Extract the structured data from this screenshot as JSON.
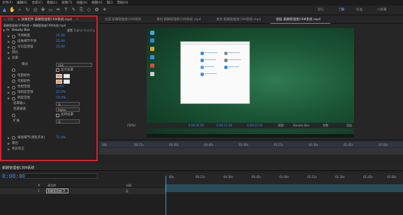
{
  "menu": [
    "文件(F)",
    "编辑(E)",
    "合成(C)",
    "图层(L)",
    "效果(T)",
    "动画(A)",
    "视图(V)",
    "窗口",
    "帮助(H)"
  ],
  "toolbar_icons": [
    "selection-tool",
    "hand-tool",
    "zoom-tool",
    "rotate-tool",
    "orbit-tool",
    "pan-behind-tool",
    "rect-mask-tool",
    "pen-tool",
    "text-tool",
    "brush-tool",
    "clone-tool",
    "eraser-tool",
    "roto-tool",
    "puppet-tool"
  ],
  "workspaces": [
    "默认",
    "了解",
    "标准",
    "小屏幕"
  ],
  "effect_panel": {
    "tabs": [
      "× 项目",
      "× 效果控件 薪酬管理者CRM系统.mp4",
      "≡"
    ],
    "path": "薪酬管理者CRM系统 • 薪酬管理者CRM系统.mp4",
    "effect_name": "Beauty Box",
    "reset_label": "重置",
    "preset_label": "Digital Anarchy",
    "rows": [
      {
        "label": "平滑数量",
        "value": "25.00",
        "kind": "stopwatch"
      },
      {
        "label": "皮肤细节平滑",
        "value": "35.00",
        "kind": "stopwatch"
      },
      {
        "label": "对比度增强",
        "value": "15.00",
        "kind": "stopwatch"
      },
      {
        "label": "锐化",
        "value": "",
        "kind": "group"
      },
      {
        "label": "遮罩",
        "value": "",
        "kind": "group-open"
      },
      {
        "label": "模式",
        "value": "自动",
        "kind": "dropdown"
      },
      {
        "label": "",
        "value": "显示遮罩",
        "kind": "checkbox"
      },
      {
        "label": "暗部颜色",
        "value": "",
        "kind": "color"
      },
      {
        "label": "亮部颜色",
        "value": "",
        "kind": "color"
      },
      {
        "label": "色相范围",
        "value": "5.0%",
        "kind": "stopwatch"
      },
      {
        "label": "饱和度范围",
        "value": "20.0%",
        "kind": "stopwatch"
      },
      {
        "label": "明度范围",
        "value": "50.0%",
        "kind": "stopwatch"
      },
      {
        "label": "遮罩输入",
        "value": "无",
        "kind": "dropdown"
      },
      {
        "label": "遮罩通道",
        "value": "Alpha",
        "kind": "dropdown"
      },
      {
        "label": "",
        "value": "反转遮罩",
        "kind": "checkbox"
      },
      {
        "label": "扩展",
        "value": "无",
        "kind": "dropdown"
      },
      {
        "label": "",
        "value": "",
        "kind": "spacer"
      },
      {
        "label": "",
        "value": "",
        "kind": "spacer"
      },
      {
        "label": "阈值细节(阴影开关)",
        "value": "75.0%",
        "kind": "stopwatch"
      },
      {
        "label": "输出",
        "value": "",
        "kind": "group"
      },
      {
        "label": "色彩校正",
        "value": "",
        "kind": "group"
      }
    ]
  },
  "composition_tabs": [
    {
      "label": "合成 薪酬管理者CRM系统",
      "active": false
    },
    {
      "label": "素材 薪酬管理者CRM系统.mp4",
      "active": false
    },
    {
      "label": "素材 薪酬管理者CRM系统.mp4",
      "active": false
    },
    {
      "label": "图层 薪酬管理者CRM系统.mp4",
      "active": true
    }
  ],
  "viewer_controls": {
    "zoom": "(50%)",
    "timecode_left": "0:00:00:00",
    "timecode_mid": "0:00:21:18",
    "timecode_right": "0:00:21:18",
    "view_label": "视图:",
    "render_label": "Beauty Box",
    "render_toggle": "渲染",
    "resolution": "完整"
  },
  "mini_timeline_ticks": [
    "00s",
    "00:15s",
    "00:30s",
    "00:45s",
    "01:00s",
    "01:15s",
    "01:30s",
    "01:45s",
    "02:00s"
  ],
  "timeline": {
    "tab_label": "薪酬管理者CRM系统",
    "timecode": "0:00:00:00",
    "columns": [
      "#",
      "源名称",
      "父级"
    ],
    "layer": {
      "index": "1",
      "name": "薪酬管理者CR",
      "parent": "无"
    },
    "ruler_ticks": [
      "00s",
      "00:15s",
      "00:30s",
      "00:45s",
      "01:00s",
      "01:15s",
      "01:30s",
      "01:45s",
      "02:00s"
    ]
  },
  "colors": {
    "accent_blue": "#3d8cf0",
    "highlight_red": "#d8202c",
    "swatch": "#e4a07a"
  }
}
